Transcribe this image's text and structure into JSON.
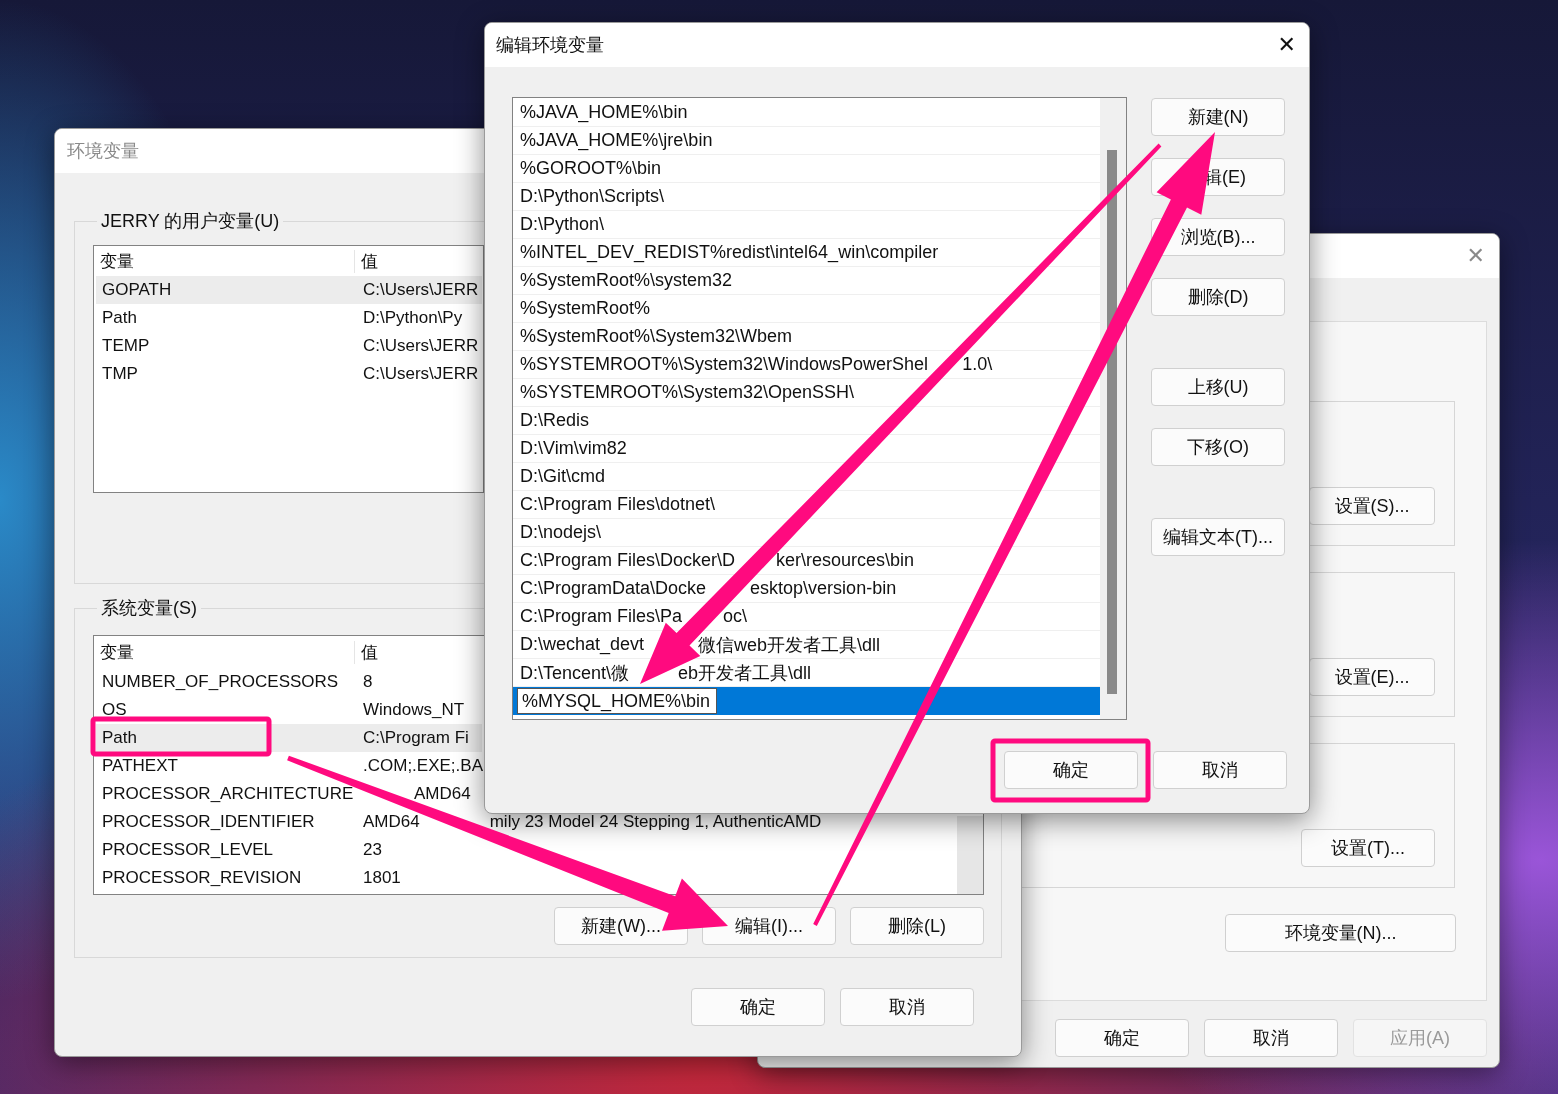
{
  "system_properties_window": {
    "group_buttons": [
      "设置(S)...",
      "设置(E)...",
      "设置(T)..."
    ],
    "env_button": "环境变量(N)...",
    "footer_buttons": [
      {
        "label": "确定",
        "disabled": false
      },
      {
        "label": "取消",
        "disabled": false
      },
      {
        "label": "应用(A)",
        "disabled": true
      }
    ]
  },
  "env_window": {
    "title": "环境变量",
    "user_group": {
      "title": "JERRY 的用户变量(U)",
      "columns": [
        "变量",
        "值"
      ],
      "rows": [
        {
          "name": "GOPATH",
          "value": "C:\\Users\\JERR",
          "selected": true
        },
        {
          "name": "Path",
          "value": "D:\\Python\\Py",
          "selected": false
        },
        {
          "name": "TEMP",
          "value": "C:\\Users\\JERR",
          "selected": false
        },
        {
          "name": "TMP",
          "value": "C:\\Users\\JERR",
          "selected": false
        }
      ]
    },
    "system_group": {
      "title": "系统变量(S)",
      "columns": [
        "变量",
        "值"
      ],
      "rows": [
        {
          "name": "NUMBER_OF_PROCESSORS",
          "value": "8",
          "selected": false
        },
        {
          "name": "OS",
          "value": "Windows_NT",
          "selected": false
        },
        {
          "name": "Path",
          "value": "C:\\Program Fi",
          "selected": true
        },
        {
          "name": "PATHEXT",
          "value": ".COM;.EXE;.BA",
          "selected": false
        },
        {
          "name": "PROCESSOR_ARCHITECTURE",
          "value": "AMD64",
          "selected": false
        },
        {
          "name": "PROCESSOR_IDENTIFIER",
          "value_parts": [
            "AMD64",
            "mily 23 Model 24 Stepping 1, AuthenticAMD"
          ],
          "selected": false
        },
        {
          "name": "PROCESSOR_LEVEL",
          "value": "23",
          "selected": false
        },
        {
          "name": "PROCESSOR_REVISION",
          "value": "1801",
          "selected": false
        }
      ],
      "buttons": [
        "新建(W)...",
        "编辑(I)...",
        "删除(L)"
      ]
    },
    "footer_buttons": [
      "确定",
      "取消"
    ]
  },
  "edit_window": {
    "title": "编辑环境变量",
    "close": "✕",
    "entries": [
      {
        "text": "%JAVA_HOME%\\bin",
        "selected": false
      },
      {
        "text": "%JAVA_HOME%\\jre\\bin",
        "selected": false
      },
      {
        "text": "%GOROOT%\\bin",
        "selected": false
      },
      {
        "text": "D:\\Python\\Scripts\\",
        "selected": false
      },
      {
        "text": "D:\\Python\\",
        "selected": false
      },
      {
        "text": "%INTEL_DEV_REDIST%redist\\intel64_win\\compiler",
        "selected": false
      },
      {
        "text": "%SystemRoot%\\system32",
        "selected": false
      },
      {
        "text": "%SystemRoot%",
        "selected": false
      },
      {
        "text": "%SystemRoot%\\System32\\Wbem",
        "selected": false
      },
      {
        "parts": [
          "%SYSTEMROOT%\\System32\\WindowsPowerShel",
          "1.0\\"
        ],
        "selected": false
      },
      {
        "text": "%SYSTEMROOT%\\System32\\OpenSSH\\",
        "selected": false
      },
      {
        "text": "D:\\Redis",
        "selected": false
      },
      {
        "text": "D:\\Vim\\vim82",
        "selected": false
      },
      {
        "text": "D:\\Git\\cmd",
        "selected": false
      },
      {
        "text": "C:\\Program Files\\dotnet\\",
        "selected": false
      },
      {
        "text": "D:\\nodejs\\",
        "selected": false
      },
      {
        "parts": [
          "C:\\Program Files\\Docker\\D",
          "ker\\resources\\bin"
        ],
        "selected": false
      },
      {
        "parts": [
          "C:\\ProgramData\\Docke",
          "esktop\\version-bin"
        ],
        "selected": false
      },
      {
        "parts": [
          "C:\\Program Files\\Pa",
          "oc\\"
        ],
        "selected": false
      },
      {
        "parts": [
          "D:\\wechat_devt",
          "微信web开发者工具\\dll"
        ],
        "selected": false
      },
      {
        "parts": [
          "D:\\Tencent\\微",
          "eb开发者工具\\dll"
        ],
        "selected": false
      },
      {
        "text": "%MYSQL_HOME%\\bin",
        "selected": true
      }
    ],
    "side_button_groups": [
      [
        "新建(N)",
        "辑(E)",
        "浏览(B)...",
        "删除(D)"
      ],
      [
        "上移(U)",
        "下移(O)"
      ],
      [
        "编辑文本(T)..."
      ]
    ],
    "footer_buttons": [
      "确定",
      "取消"
    ]
  }
}
